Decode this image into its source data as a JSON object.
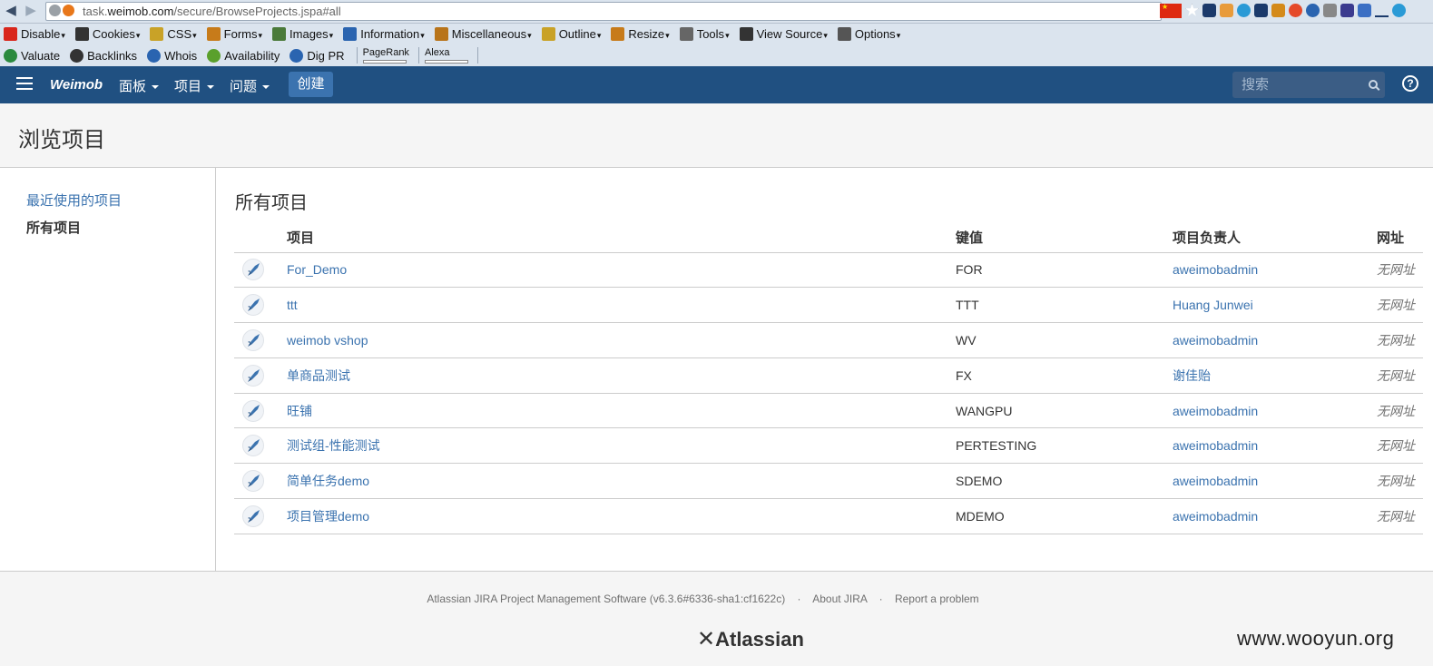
{
  "browser": {
    "url_prefix": "task.",
    "url_host": "weimob.com",
    "url_path": "/secure/BrowseProjects.jspa#all"
  },
  "webdev_toolbar": [
    {
      "label": "Disable",
      "icon": "disable-icon",
      "color": "#d9261c"
    },
    {
      "label": "Cookies",
      "icon": "cookies-icon",
      "color": "#333333"
    },
    {
      "label": "CSS",
      "icon": "css-icon",
      "color": "#c9a227"
    },
    {
      "label": "Forms",
      "icon": "forms-icon",
      "color": "#c77b1a"
    },
    {
      "label": "Images",
      "icon": "images-icon",
      "color": "#4a7a3a"
    },
    {
      "label": "Information",
      "icon": "information-icon",
      "color": "#2a64b0"
    },
    {
      "label": "Miscellaneous",
      "icon": "miscellaneous-icon",
      "color": "#b8741a"
    },
    {
      "label": "Outline",
      "icon": "outline-icon",
      "color": "#c9a227"
    },
    {
      "label": "Resize",
      "icon": "resize-icon",
      "color": "#c77b1a"
    },
    {
      "label": "Tools",
      "icon": "tools-icon",
      "color": "#666666"
    },
    {
      "label": "View Source",
      "icon": "view-source-icon",
      "color": "#333333"
    },
    {
      "label": "Options",
      "icon": "options-icon",
      "color": "#555555"
    }
  ],
  "seo_toolbar": [
    {
      "label": "Valuate",
      "icon": "dollar-icon",
      "color": "#2b8a3e"
    },
    {
      "label": "Backlinks",
      "icon": "backlinks-icon",
      "color": "#333333"
    },
    {
      "label": "Whois",
      "icon": "globe-icon",
      "color": "#2a64b0"
    },
    {
      "label": "Availability",
      "icon": "magnifier-icon",
      "color": "#5aa02c"
    },
    {
      "label": "Dig PR",
      "icon": "network-icon",
      "color": "#2a64b0"
    }
  ],
  "seo_ranks": {
    "pagerank": "PageRank",
    "alexa": "Alexa"
  },
  "header": {
    "logo": "Weimob",
    "menus": [
      "面板",
      "项目",
      "问题"
    ],
    "create": "创建",
    "search_placeholder": "搜索",
    "help": "?"
  },
  "page": {
    "title": "浏览项目",
    "sidebar": {
      "recent": "最近使用的项目",
      "all": "所有项目"
    },
    "section_title": "所有项目"
  },
  "table": {
    "headers": [
      "项目",
      "键值",
      "项目负责人",
      "网址"
    ],
    "rows": [
      {
        "name": "For_Demo",
        "key": "FOR",
        "lead": "aweimobadmin",
        "url": "无网址"
      },
      {
        "name": "ttt",
        "key": "TTT",
        "lead": "Huang Junwei",
        "url": "无网址"
      },
      {
        "name": "weimob vshop",
        "key": "WV",
        "lead": "aweimobadmin",
        "url": "无网址"
      },
      {
        "name": "单商品测试",
        "key": "FX",
        "lead": "谢佳贻",
        "url": "无网址"
      },
      {
        "name": "旺铺",
        "key": "WANGPU",
        "lead": "aweimobadmin",
        "url": "无网址"
      },
      {
        "name": "测试组-性能测试",
        "key": "PERTESTING",
        "lead": "aweimobadmin",
        "url": "无网址"
      },
      {
        "name": "简单任务demo",
        "key": "SDEMO",
        "lead": "aweimobadmin",
        "url": "无网址"
      },
      {
        "name": "项目管理demo",
        "key": "MDEMO",
        "lead": "aweimobadmin",
        "url": "无网址"
      }
    ]
  },
  "footer": {
    "software": "Atlassian JIRA Project Management Software (v6.3.6#6336-sha1:cf1622c)",
    "sep": "·",
    "about": "About JIRA",
    "report": "Report a problem",
    "logo": "Atlassian"
  },
  "watermark": "www.wooyun.org",
  "colors": {
    "header_bg": "#205081",
    "link": "#3b73af",
    "create_bg": "#3b73af"
  }
}
